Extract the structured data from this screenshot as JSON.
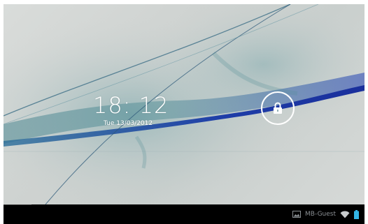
{
  "lock_screen": {
    "time": "18: 12",
    "date": "Tue 13/03/2012"
  },
  "icons": {
    "unlock": "padlock-icon",
    "gallery": "gallery-icon",
    "wifi": "wifi-icon",
    "battery": "battery-icon"
  },
  "status_bar": {
    "network_name": "MB-Guest"
  },
  "colors": {
    "wallpaper_base": "#cfd3d1",
    "wallpaper_teal": "#4f8c95",
    "wallpaper_blue": "#1f3fb3",
    "clock_text": "#ffffff",
    "status_accent": "#33b5e5",
    "nav_bar": "#000000"
  }
}
